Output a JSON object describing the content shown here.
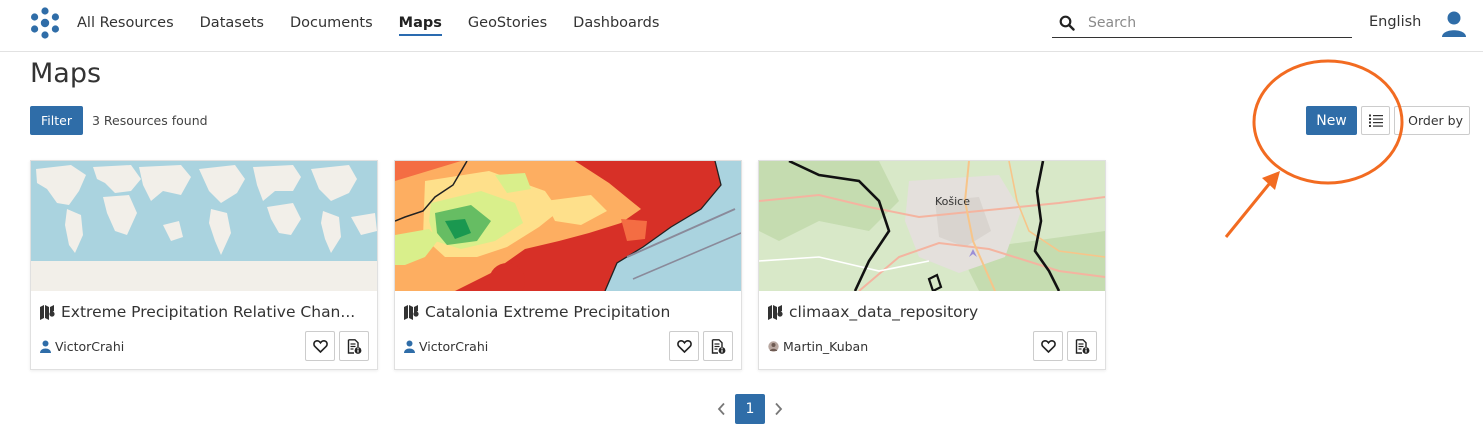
{
  "header": {
    "nav": [
      "All Resources",
      "Datasets",
      "Documents",
      "Maps",
      "GeoStories",
      "Dashboards"
    ],
    "active_nav": "Maps",
    "search_placeholder": "Search",
    "language": "English",
    "accent_color": "#2f6da8"
  },
  "page": {
    "title": "Maps",
    "filter_label": "Filter",
    "results_text": "3 Resources found",
    "new_label": "New",
    "order_label": "Order by"
  },
  "cards": [
    {
      "title": "Extreme Precipitation Relative Chan...",
      "owner": "VictorCrahi",
      "thumbnail": "world-map"
    },
    {
      "title": "Catalonia Extreme Precipitation",
      "owner": "VictorCrahi",
      "thumbnail": "catalonia-heatmap"
    },
    {
      "title": "climaax_data_repository",
      "owner": "Martin_Kuban",
      "thumbnail": "kosice-osm-map",
      "thumbnail_label": "Košice"
    }
  ],
  "pagination": {
    "current": "1"
  },
  "icons": {
    "logo": "geonode-logo-icon",
    "search": "search-icon",
    "user": "user-icon",
    "list": "list-view-icon",
    "map": "map-icon",
    "favorite": "heart-icon",
    "info": "document-info-icon",
    "prev": "chevron-left-icon",
    "next": "chevron-right-icon"
  },
  "annotation_color": "#f26b21"
}
